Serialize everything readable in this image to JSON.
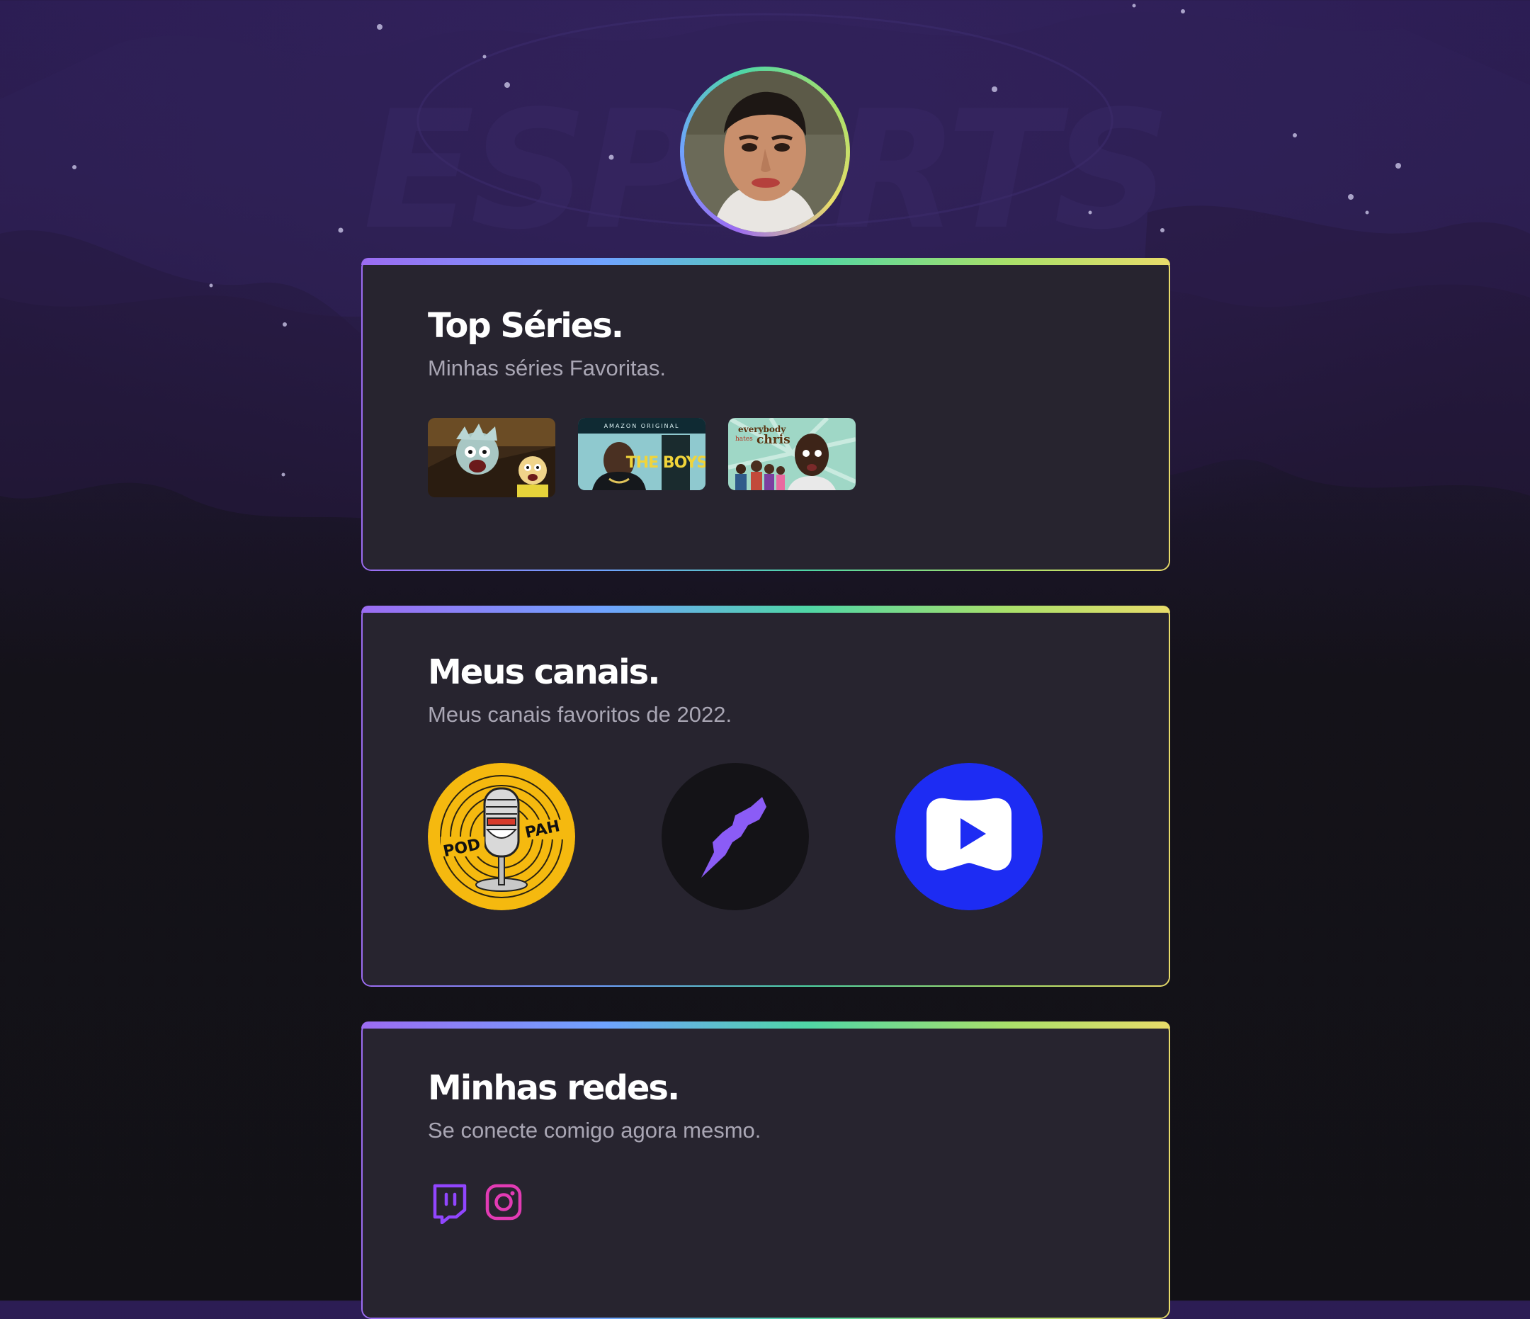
{
  "colors": {
    "card_bg": "#27242f",
    "accent_gradient": [
      "#9c6cf2",
      "#6fa3ff",
      "#4fd6a6",
      "#a9e06a",
      "#e8dc6a"
    ],
    "twitch_purple": "#9146ff",
    "instagram_pink": "#e23bb4",
    "channel_yellow": "#f5b90f",
    "channel_blue": "#1d2cf3"
  },
  "profile": {
    "avatar_icon": "profile-photo"
  },
  "series_section": {
    "title": "Top Séries.",
    "subtitle": "Minhas séries Favoritas.",
    "items": [
      {
        "icon": "rick-and-morty-poster"
      },
      {
        "icon": "the-boys-poster",
        "caption_top": "AMAZON ORIGINAL",
        "logo": "THE BOYS"
      },
      {
        "icon": "everybody-hates-chris-poster",
        "logo_top": "everybody",
        "logo_mid": "hates",
        "logo_main": "chris"
      }
    ]
  },
  "channels_section": {
    "title": "Meus canais.",
    "subtitle": "Meus canais favoritos de 2022.",
    "items": [
      {
        "icon": "podpah-logo",
        "left": "POD",
        "right": "PAH"
      },
      {
        "icon": "purple-knife-logo"
      },
      {
        "icon": "play-button-logo"
      }
    ]
  },
  "social_section": {
    "title": "Minhas redes.",
    "subtitle": "Se conecte comigo agora mesmo.",
    "items": [
      {
        "icon": "twitch-icon"
      },
      {
        "icon": "instagram-icon"
      }
    ]
  }
}
